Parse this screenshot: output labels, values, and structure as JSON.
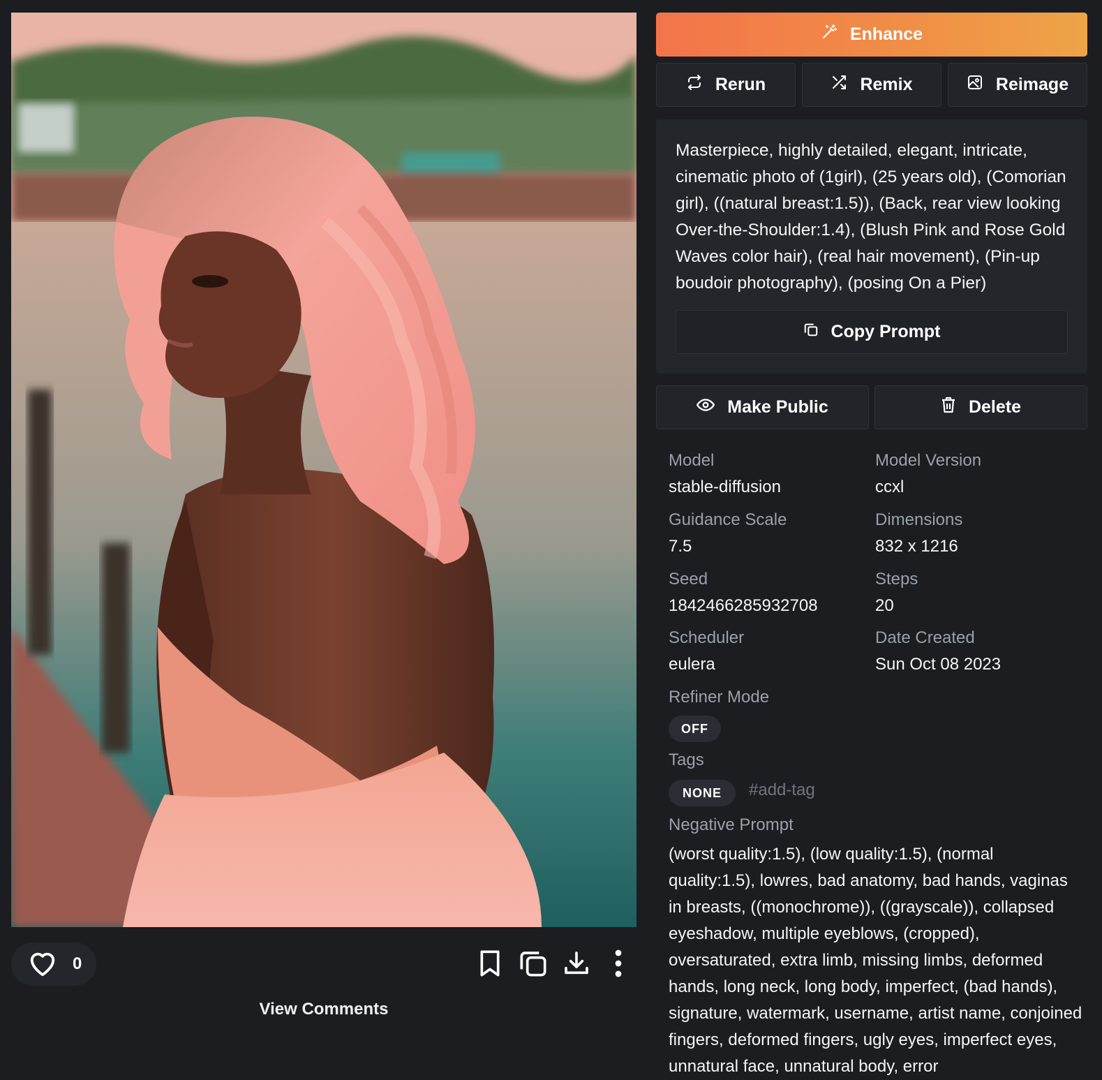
{
  "actions": {
    "enhance_label": "Enhance",
    "rerun_label": "Rerun",
    "remix_label": "Remix",
    "reimage_label": "Reimage",
    "copy_prompt_label": "Copy Prompt",
    "make_public_label": "Make Public",
    "delete_label": "Delete"
  },
  "prompt": "Masterpiece, highly detailed, elegant, intricate, cinematic photo of (1girl), (25 years old), (Comorian girl), ((natural breast:1.5)), (Back, rear view looking Over-the-Shoulder:1.4), (Blush Pink and Rose Gold Waves color hair), (real hair movement), (Pin-up boudoir photography), (posing On a Pier)",
  "meta": {
    "model_label": "Model",
    "model_value": "stable-diffusion",
    "model_version_label": "Model Version",
    "model_version_value": "ccxl",
    "guidance_label": "Guidance Scale",
    "guidance_value": "7.5",
    "dimensions_label": "Dimensions",
    "dimensions_value": "832 x 1216",
    "seed_label": "Seed",
    "seed_value": "1842466285932708",
    "steps_label": "Steps",
    "steps_value": "20",
    "scheduler_label": "Scheduler",
    "scheduler_value": "eulera",
    "date_label": "Date Created",
    "date_value": "Sun Oct 08 2023",
    "refiner_label": "Refiner Mode",
    "refiner_value": "OFF",
    "tags_label": "Tags",
    "tags_value": "NONE",
    "add_tag": "#add-tag",
    "negative_label": "Negative Prompt",
    "negative_value": "(worst quality:1.5), (low quality:1.5), (normal quality:1.5), lowres, bad anatomy, bad hands, vaginas in breasts, ((monochrome)), ((grayscale)), collapsed eyeshadow, multiple eyeblows, (cropped), oversaturated, extra limb, missing limbs, deformed hands, long neck, long body, imperfect, (bad hands), signature, watermark, username, artist name, conjoined fingers, deformed fingers, ugly eyes, imperfect eyes, unnatural face, unnatural body, error"
  },
  "social": {
    "like_count": "0",
    "view_comments": "View Comments"
  },
  "icons": {
    "enhance": "magic-wand-icon",
    "rerun": "repeat-icon",
    "remix": "shuffle-icon",
    "reimage": "image-icon",
    "copy": "copy-icon",
    "make_public": "eye-icon",
    "delete": "trash-icon",
    "like": "heart-icon",
    "bookmark": "bookmark-icon",
    "duplicate": "duplicate-icon",
    "download": "download-icon",
    "more": "more-vertical-icon"
  },
  "colors": {
    "background": "#1b1d21",
    "card": "#23262b",
    "enhance_gradient_start": "#f3744a",
    "enhance_gradient_end": "#eea447",
    "muted_text": "#9aa1aa"
  }
}
